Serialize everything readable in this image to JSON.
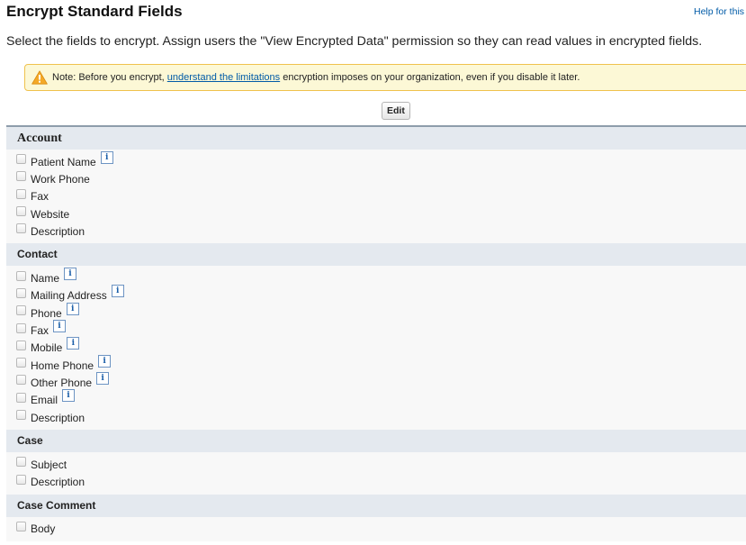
{
  "header": {
    "title": "Encrypt Standard Fields",
    "help_link": "Help for this Page"
  },
  "description": "Select the fields to encrypt. Assign users the \"View Encrypted Data\" permission so they can read values in encrypted fields.",
  "note": {
    "icon": "warning-icon",
    "prefix": "Note: Before you encrypt, ",
    "link_text": "understand the limitations",
    "suffix": " encryption imposes on your organization, even if you disable it later."
  },
  "edit_button": {
    "label": "Edit"
  },
  "colors": {
    "section_header_bg": "#e4e9ef",
    "section_top_border": "#8e9dab",
    "note_bg": "#fcf8d6",
    "note_border": "#f0c24d",
    "link": "#015ba7"
  },
  "sections": [
    {
      "title": "Account",
      "fields": [
        {
          "label": "Patient Name",
          "info": true
        },
        {
          "label": "Work Phone",
          "info": false
        },
        {
          "label": "Fax",
          "info": false
        },
        {
          "label": "Website",
          "info": false
        },
        {
          "label": "Description",
          "info": false
        }
      ]
    },
    {
      "title": "Contact",
      "fields": [
        {
          "label": "Name",
          "info": true
        },
        {
          "label": "Mailing Address",
          "info": true
        },
        {
          "label": "Phone",
          "info": true
        },
        {
          "label": "Fax",
          "info": true
        },
        {
          "label": "Mobile",
          "info": true
        },
        {
          "label": "Home Phone",
          "info": true
        },
        {
          "label": "Other Phone",
          "info": true
        },
        {
          "label": "Email",
          "info": true
        },
        {
          "label": "Description",
          "info": false
        }
      ]
    },
    {
      "title": "Case",
      "fields": [
        {
          "label": "Subject",
          "info": false
        },
        {
          "label": "Description",
          "info": false
        }
      ]
    },
    {
      "title": "Case Comment",
      "fields": [
        {
          "label": "Body",
          "info": false
        }
      ]
    }
  ],
  "info_icon_glyph": "i"
}
